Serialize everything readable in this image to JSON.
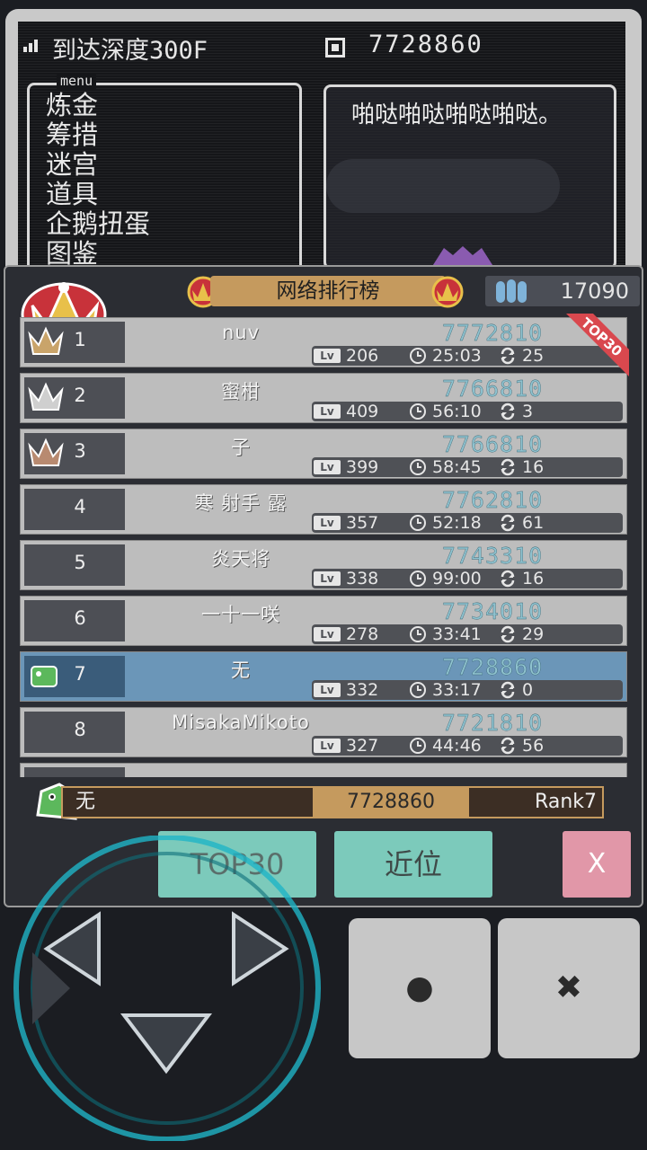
{
  "status": {
    "depth": "到达深度300F",
    "gold": "7728860"
  },
  "menu": {
    "title": "menu",
    "items": [
      "炼金",
      "筹措",
      "迷宫",
      "道具",
      "企鹅扭蛋",
      "图鉴"
    ]
  },
  "dialog": {
    "text": "啪哒啪哒啪哒啪哒。"
  },
  "ranking": {
    "title": "网络排行榜",
    "medals": "17090",
    "top_tag": "TOP30",
    "rows": [
      {
        "rank": "1",
        "name": "nuv",
        "score": "7772810",
        "lv": "206",
        "time": "25:03",
        "loops": "25"
      },
      {
        "rank": "2",
        "name": "蜜柑",
        "score": "7766810",
        "lv": "409",
        "time": "56:10",
        "loops": "3"
      },
      {
        "rank": "3",
        "name": "子",
        "score": "7766810",
        "lv": "399",
        "time": "58:45",
        "loops": "16"
      },
      {
        "rank": "4",
        "name": "寒 射手 露",
        "score": "7762810",
        "lv": "357",
        "time": "52:18",
        "loops": "61"
      },
      {
        "rank": "5",
        "name": "炎天将",
        "score": "7743310",
        "lv": "338",
        "time": "99:00",
        "loops": "16"
      },
      {
        "rank": "6",
        "name": "一十一咲",
        "score": "7734010",
        "lv": "278",
        "time": "33:41",
        "loops": "29"
      },
      {
        "rank": "7",
        "name": "无",
        "score": "7728860",
        "lv": "332",
        "time": "33:17",
        "loops": "0"
      },
      {
        "rank": "8",
        "name": "MisakaMikoto",
        "score": "7721810",
        "lv": "327",
        "time": "44:46",
        "loops": "56"
      }
    ],
    "lv_label": "Lv",
    "me": {
      "name": "无",
      "score": "7728860",
      "rank": "Rank7"
    },
    "buttons": {
      "top30": "TOP30",
      "near": "近位",
      "close": "X"
    }
  },
  "controller": {
    "a": "●",
    "b": "✖"
  },
  "colors": {
    "accent": "#7ccabb",
    "gold": "#c59a5e",
    "highlight": "#6b96b8",
    "close": "#e197a8",
    "score": "#8fc2cf"
  }
}
